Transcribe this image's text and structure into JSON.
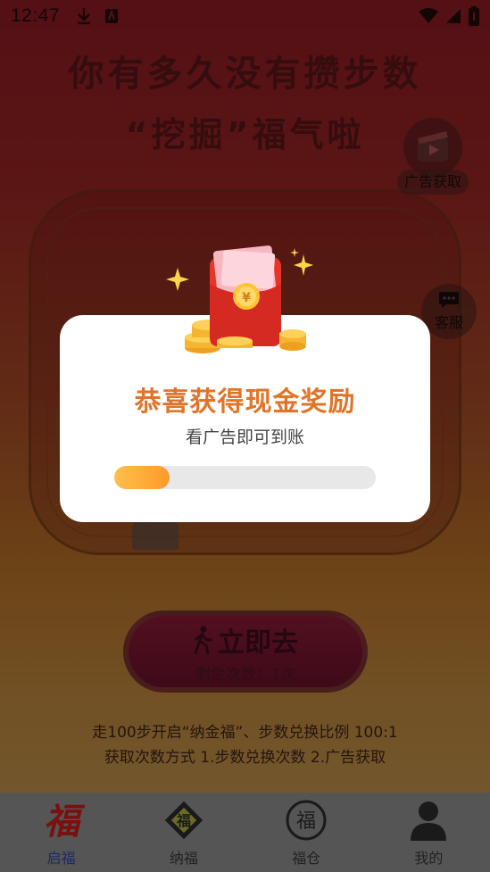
{
  "status_bar": {
    "time": "12:47"
  },
  "headline": {
    "line1": "你有多久没有攒步数",
    "line2": "“挖掘”福气啦"
  },
  "side_buttons": {
    "ad_label": "广告获取",
    "service_label": "客服"
  },
  "go_button": {
    "title": "立即去",
    "remaining": "剩余次数：1次"
  },
  "rules": {
    "line1": "走100步开启“纳金福”、步数兑换比例 100:1",
    "line2": "获取次数方式 1.步数兑换次数 2.广告获取"
  },
  "modal": {
    "title": "恭喜获得现金奖励",
    "subtitle": "看广告即可到账",
    "progress_fraction": 0.21
  },
  "tabbar": {
    "items": [
      {
        "label": "启福",
        "icon": "fu-calligraphy-icon",
        "active": true
      },
      {
        "label": "纳福",
        "icon": "fu-diamond-icon",
        "active": false
      },
      {
        "label": "福仓",
        "icon": "fu-circle-icon",
        "active": false
      },
      {
        "label": "我的",
        "icon": "person-icon",
        "active": false
      }
    ]
  },
  "colors": {
    "accent_orange": "#e0752a",
    "progress_fill": "#ff9a2a",
    "tabbar_bg": "#555555"
  }
}
